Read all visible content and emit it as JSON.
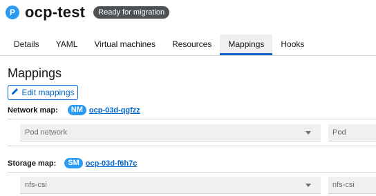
{
  "header": {
    "plan_icon_letter": "P",
    "title": "ocp-test",
    "status": "Ready for migration"
  },
  "tabs": [
    {
      "label": "Details",
      "active": false
    },
    {
      "label": "YAML",
      "active": false
    },
    {
      "label": "Virtual machines",
      "active": false
    },
    {
      "label": "Resources",
      "active": false
    },
    {
      "label": "Mappings",
      "active": true
    },
    {
      "label": "Hooks",
      "active": false
    }
  ],
  "mappings": {
    "title": "Mappings",
    "edit_button_label": "Edit mappings",
    "edit_icon": "pencil-icon",
    "network": {
      "label": "Network map:",
      "badge": "NM",
      "name": "ocp-03d-qgfzz",
      "source": "Pod network",
      "target": "Pod"
    },
    "storage": {
      "label": "Storage map:",
      "badge": "SM",
      "name": "ocp-03d-f6h7c",
      "source": "nfs-csi",
      "target": "nfs-csi"
    }
  },
  "colors": {
    "accent": "#0066cc",
    "badge_blue": "#2b9af3",
    "status_bg": "#4f5255"
  }
}
